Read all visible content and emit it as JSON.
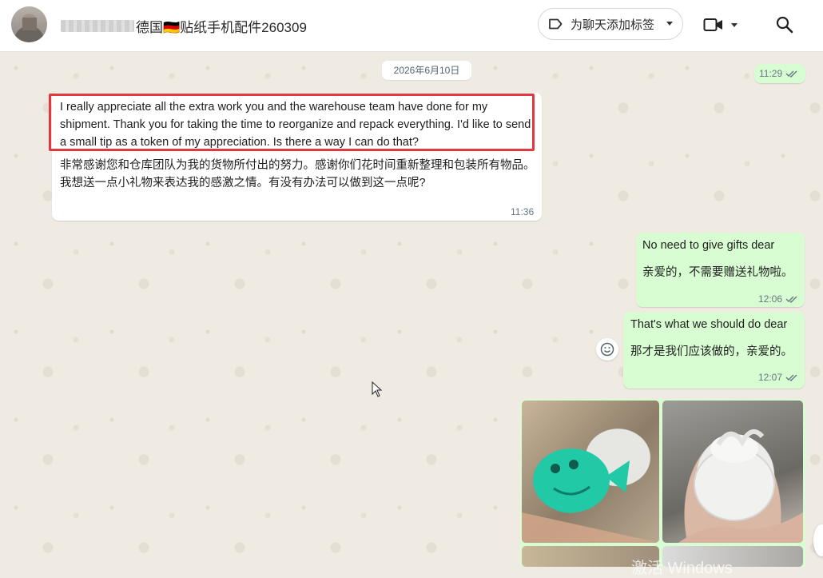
{
  "header": {
    "contact_name": "德国🇩🇪贴纸手机配件260309",
    "tag_button_label": "为聊天添加标签",
    "icons": [
      "label-icon",
      "video-call-icon",
      "search-icon"
    ]
  },
  "chat": {
    "date_chip": "2026年6月10日",
    "messages": [
      {
        "direction": "outgoing",
        "time": "11:29",
        "status": "read"
      },
      {
        "direction": "incoming",
        "text_en": "I really appreciate all the extra work you and the warehouse team have done for my shipment. Thank you for taking the time to reorganize and repack everything. I'd like to send a small tip as a token of my appreciation. Is there a way I can do that?",
        "text_zh": "非常感谢您和仓库团队为我的货物所付出的努力。感谢你们花时间重新整理和包装所有物品。我想送一点小礼物来表达我的感激之情。有没有办法可以做到这一点呢?",
        "time": "11:36",
        "highlighted": true
      },
      {
        "direction": "outgoing",
        "line1": "No need to give gifts dear",
        "line2": "亲爱的，不需要赠送礼物啦。",
        "time": "12:06",
        "status": "read"
      },
      {
        "direction": "outgoing",
        "line1": "That's what we should do dear",
        "line2": "那才是我们应该做的，亲爱的。",
        "time": "12:07",
        "status": "read"
      },
      {
        "direction": "outgoing",
        "type": "image-grid",
        "images": [
          "green-fish-toy-photo",
          "white-angel-wings-box-photo",
          "photo-3",
          "photo-4"
        ]
      }
    ],
    "watermark": "激活 Windows"
  },
  "colors": {
    "chat_bg": "#efeae2",
    "incoming_bubble": "#ffffff",
    "outgoing_bubble": "#d9fdd3",
    "highlight_border": "#e2383f",
    "read_checks": "#667781"
  }
}
